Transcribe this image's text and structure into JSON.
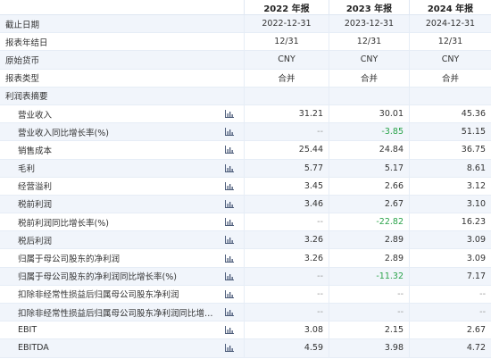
{
  "columns": [
    "2022 年报",
    "2023 年报",
    "2024 年报"
  ],
  "meta_rows": [
    {
      "label": "截止日期",
      "values": [
        "2022-12-31",
        "2023-12-31",
        "2024-12-31"
      ]
    },
    {
      "label": "报表年结日",
      "values": [
        "12/31",
        "12/31",
        "12/31"
      ]
    },
    {
      "label": "原始货币",
      "values": [
        "CNY",
        "CNY",
        "CNY"
      ]
    },
    {
      "label": "报表类型",
      "values": [
        "合并",
        "合并",
        "合并"
      ]
    }
  ],
  "section_title": "利润表摘要",
  "data_rows": [
    {
      "label": "营业收入",
      "values": [
        "31.21",
        "30.01",
        "45.36"
      ]
    },
    {
      "label": "营业收入同比增长率(%)",
      "values": [
        "--",
        "-3.85",
        "51.15"
      ]
    },
    {
      "label": "销售成本",
      "values": [
        "25.44",
        "24.84",
        "36.75"
      ]
    },
    {
      "label": "毛利",
      "values": [
        "5.77",
        "5.17",
        "8.61"
      ]
    },
    {
      "label": "经营溢利",
      "values": [
        "3.45",
        "2.66",
        "3.12"
      ]
    },
    {
      "label": "税前利润",
      "values": [
        "3.46",
        "2.67",
        "3.10"
      ]
    },
    {
      "label": "税前利润同比增长率(%)",
      "values": [
        "--",
        "-22.82",
        "16.23"
      ]
    },
    {
      "label": "税后利润",
      "values": [
        "3.26",
        "2.89",
        "3.09"
      ]
    },
    {
      "label": "归属于母公司股东的净利润",
      "values": [
        "3.26",
        "2.89",
        "3.09"
      ]
    },
    {
      "label": "归属于母公司股东的净利润同比增长率(%)",
      "values": [
        "--",
        "-11.32",
        "7.17"
      ]
    },
    {
      "label": "扣除非经常性损益后归属母公司股东净利润",
      "values": [
        "--",
        "--",
        "--"
      ]
    },
    {
      "label": "扣除非经常性损益后归属母公司股东净利润同比增长...",
      "values": [
        "--",
        "--",
        "--"
      ]
    },
    {
      "label": "EBIT",
      "values": [
        "3.08",
        "2.15",
        "2.67"
      ]
    },
    {
      "label": "EBITDA",
      "values": [
        "4.59",
        "3.98",
        "4.72"
      ]
    }
  ],
  "colors": {
    "negative": "#2aa34a",
    "row_alt": "#f1f5fb",
    "icon": "#4a5a78"
  },
  "icons": {
    "row_chart": "bar-chart-icon"
  }
}
